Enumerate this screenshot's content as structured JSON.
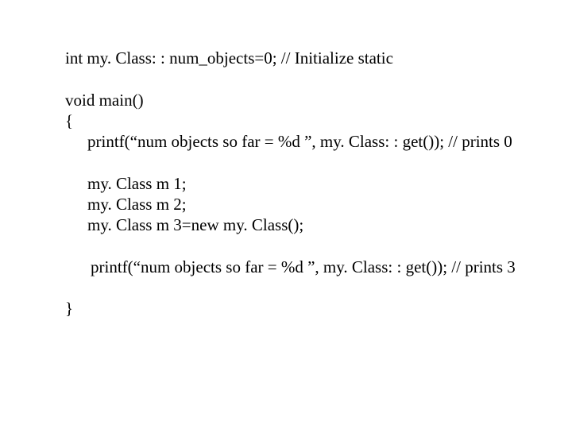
{
  "code": {
    "line1": "int my. Class: : num_objects=0; // Initialize static",
    "line2": "void main()",
    "line3": "{",
    "line4": "printf(“num objects so far = %d ”, my. Class: : get()); // prints 0",
    "line5": "my. Class m 1;",
    "line6": "my. Class m 2;",
    "line7": "my. Class m 3=new my. Class();",
    "line8": "printf(“num objects so far = %d ”, my. Class: : get()); // prints 3",
    "line9": "}"
  }
}
